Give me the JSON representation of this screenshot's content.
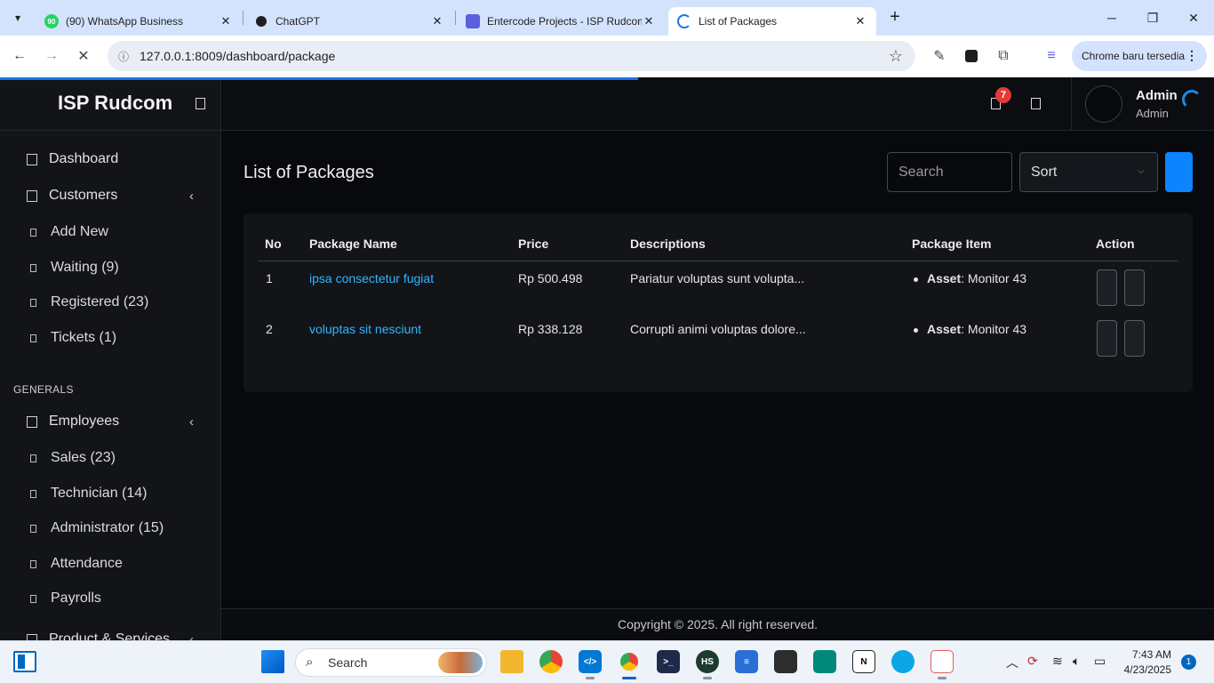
{
  "browser": {
    "tabs": [
      {
        "title": "(90) WhatsApp Business",
        "icon": "whatsapp-icon",
        "badge": "90"
      },
      {
        "title": "ChatGPT",
        "icon": "chatgpt-icon"
      },
      {
        "title": "Entercode Projects - ISP Rudcom",
        "icon": "entercode-icon"
      },
      {
        "title": "List of Packages",
        "icon": "loading-icon"
      }
    ],
    "url": "127.0.0.1:8009/dashboard/package",
    "update_label": "Chrome baru tersedia"
  },
  "app": {
    "brand": "ISP Rudcom",
    "user": {
      "name": "Admin",
      "role": "Admin"
    },
    "notification_count": "7",
    "nav": {
      "dashboard": "Dashboard",
      "customers": "Customers",
      "customers_sub": [
        "Add New",
        "Waiting (9)",
        "Registered (23)",
        "Tickets (1)"
      ],
      "generals_header": "GENERALS",
      "employees": "Employees",
      "employees_sub": [
        "Sales (23)",
        "Technician (14)",
        "Administrator (15)",
        "Attendance",
        "Payrolls"
      ],
      "product_services": "Product & Services"
    },
    "page_title": "List of Packages",
    "search_placeholder": "Search",
    "sort_label": "Sort",
    "table": {
      "headers": [
        "No",
        "Package Name",
        "Price",
        "Descriptions",
        "Package Item",
        "Action"
      ],
      "rows": [
        {
          "no": "1",
          "name": "ipsa consectetur fugiat",
          "price": "Rp 500.498",
          "description": "Pariatur voluptas sunt volupta...",
          "item_label": "Asset",
          "item_value": ": Monitor 43"
        },
        {
          "no": "2",
          "name": "voluptas sit nesciunt",
          "price": "Rp 338.128",
          "description": "Corrupti animi voluptas dolore...",
          "item_label": "Asset",
          "item_value": ": Monitor 43"
        }
      ]
    },
    "footer": "Copyright © 2025. All right reserved."
  },
  "taskbar": {
    "search_label": "Search",
    "time": "7:43 AM",
    "date": "4/23/2025",
    "notifications": "1"
  },
  "colors": {
    "accent": "#0d84ff",
    "link": "#33b5ff",
    "badge": "#e53935",
    "background": "#07090c",
    "sidebar": "#121418"
  }
}
